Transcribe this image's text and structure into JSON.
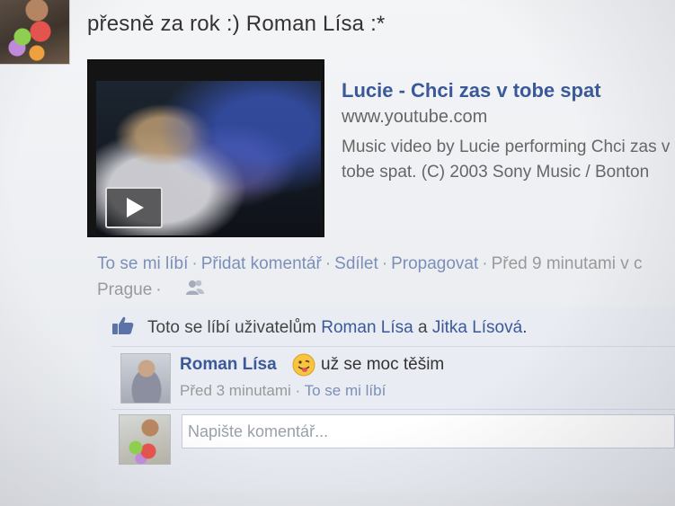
{
  "post": {
    "message": "přesně za rok :) Roman Lísa :*"
  },
  "attachment": {
    "title": "Lucie - Chci zas v tobe spat",
    "domain": "www.youtube.com",
    "description": "Music video by Lucie performing Chci zas v tobe spat. (C) 2003 Sony Music / Bonton",
    "play_icon": "play-icon"
  },
  "actions": {
    "like": "To se mi líbí",
    "comment": "Přidat komentář",
    "share": "Sdílet",
    "promote": "Propagovat",
    "time": "Před 9 minutami v c",
    "location": "Prague",
    "audience_icon": "people-icon",
    "separator": "·"
  },
  "likes": {
    "prefix": "Toto se líbí uživatelům",
    "user1": "Roman Lísa",
    "joiner": "a",
    "user2": "Jitka Lísová",
    "suffix": ".",
    "icon": "thumbs-up-icon"
  },
  "comments": [
    {
      "author": "Roman Lísa",
      "emoji_icon": "smiley-tongue-icon",
      "text": "už se moc těšim",
      "time": "Před 3 minutami",
      "like_label": "To se mi líbí"
    }
  ],
  "composer": {
    "placeholder": "Napište komentář..."
  },
  "colors": {
    "link": "#3b5998",
    "muted_link": "#7c8fb8",
    "ufi_background": "#e9ecf3"
  }
}
